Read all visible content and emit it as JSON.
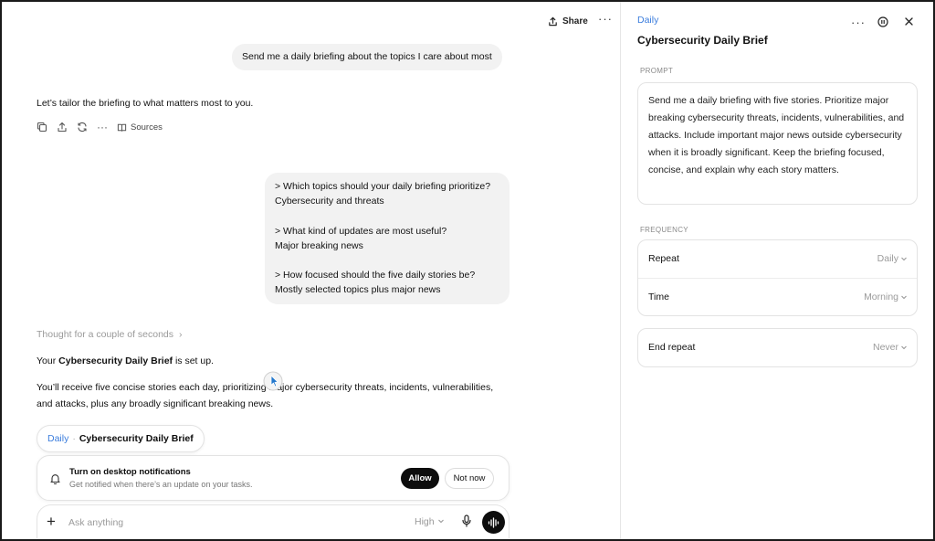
{
  "chat": {
    "share_label": "Share",
    "user_message_1": "Send me a daily briefing about the topics I care about most",
    "assistant_reply_1": "Let’s tailor the briefing to what matters most to you.",
    "sources_label": "Sources",
    "user_message_2": {
      "q1": "> Which topics should your daily briefing prioritize?",
      "a1": "Cybersecurity and threats",
      "q2": "> What kind of updates are most useful?",
      "a2": "Major breaking news",
      "q3": "> How focused should the five daily stories be?",
      "a3": "Mostly selected topics plus major news"
    },
    "thought_label": "Thought for a couple of seconds",
    "setup_prefix": "Your ",
    "setup_name": "Cybersecurity Daily Brief",
    "setup_suffix": " is set up.",
    "summary": "You’ll receive five concise stories each day, prioritizing major cybersecurity threats, incidents, vulnerabilities, and attacks, plus any broadly significant breaking news.",
    "chip_tag": "Daily",
    "chip_sep": "·",
    "chip_name": "Cybersecurity Daily Brief"
  },
  "notification": {
    "title": "Turn on desktop notifications",
    "subtitle": "Get notified when there’s an update on your tasks.",
    "allow_label": "Allow",
    "not_now_label": "Not now"
  },
  "composer": {
    "placeholder": "Ask anything",
    "mode": "High"
  },
  "panel": {
    "tag": "Daily",
    "title": "Cybersecurity Daily Brief",
    "prompt_label": "PROMPT",
    "prompt_text": "Send me a daily briefing with five stories. Prioritize major breaking cybersecurity threats, incidents, vulnerabilities, and attacks. Include important major news outside cybersecurity when it is broadly significant. Keep the briefing focused, concise, and explain why each story matters.",
    "frequency_label": "FREQUENCY",
    "repeat_label": "Repeat",
    "repeat_value": "Daily",
    "time_label": "Time",
    "time_value": "Morning",
    "end_label": "End repeat",
    "end_value": "Never"
  },
  "colors": {
    "accent": "#3b7ddd",
    "primary_button": "#0d0d0d",
    "bubble": "#f2f2f2"
  }
}
